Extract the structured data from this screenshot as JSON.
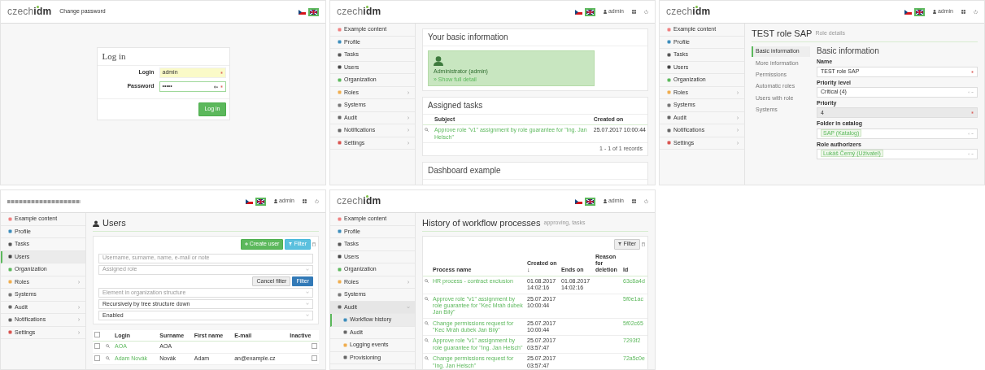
{
  "screens": [
    {
      "kind": "login",
      "header": {
        "logo": {
          "kind": "text",
          "text": "czech**idm**"
        },
        "links": [
          "Change password"
        ],
        "languages": [
          {
            "selected": false
          },
          {
            "selected": true
          }
        ]
      },
      "login": {
        "title": "Log in",
        "fields": [
          {
            "label": "Login",
            "value": "admin",
            "required": true,
            "autofilled": true,
            "secret": false
          },
          {
            "label": "Password",
            "value": "•••••",
            "required": true,
            "autofilled": false,
            "secret": true
          }
        ],
        "button": "Log in"
      }
    },
    {
      "kind": "dashboard",
      "header": {
        "logo": {
          "kind": "text",
          "text": "czech**idm**"
        },
        "languages": [
          {
            "selected": false
          },
          {
            "selected": true
          }
        ],
        "user": "admin"
      },
      "sidebar": [
        {
          "label": "Example content",
          "color": "#f08080",
          "has_submenu": false,
          "expanded": false,
          "selected": false
        },
        {
          "label": "Profile",
          "color": "#3c8dbc",
          "has_submenu": false,
          "expanded": false,
          "selected": false
        },
        {
          "label": "Tasks",
          "color": "#555555",
          "has_submenu": false,
          "expanded": false,
          "selected": false
        },
        {
          "label": "Users",
          "color": "#444444",
          "has_submenu": false,
          "expanded": false,
          "selected": false
        },
        {
          "label": "Organization",
          "color": "#5cb85c",
          "has_submenu": false,
          "expanded": false,
          "selected": false
        },
        {
          "label": "Roles",
          "color": "#f0ad4e",
          "has_submenu": true,
          "expanded": false,
          "selected": false
        },
        {
          "label": "Systems",
          "color": "#777777",
          "has_submenu": false,
          "expanded": false,
          "selected": false
        },
        {
          "label": "Audit",
          "color": "#666666",
          "has_submenu": true,
          "expanded": false,
          "selected": false
        },
        {
          "label": "Notifications",
          "color": "#666666",
          "has_submenu": true,
          "expanded": false,
          "selected": false
        },
        {
          "label": "Settings",
          "color": "#d9534f",
          "has_submenu": true,
          "expanded": false,
          "selected": false
        }
      ],
      "cards": [
        {
          "kind": "identity",
          "title": "Your basic information",
          "name": "Administrator (admin)",
          "link": "» Show full detail"
        },
        {
          "kind": "tasks",
          "title": "Assigned tasks",
          "columns": [
            "Subject",
            "Created on"
          ],
          "rows": [
            [
              "Approve role \"v1\" assignment by role guarantee for \"Ing. Jan Helsch\"",
              "25.07.2017 10:00:44"
            ]
          ],
          "pagination": "1 - 1 of 1 records"
        },
        {
          "kind": "notice",
          "title": "Dashboard example"
        }
      ]
    },
    {
      "kind": "role_detail",
      "header": {
        "logo": {
          "kind": "text",
          "text": "czech**idm**"
        },
        "languages": [
          {
            "selected": false
          },
          {
            "selected": true
          }
        ],
        "user": "admin"
      },
      "sidebar": [
        {
          "label": "Example content",
          "color": "#f08080",
          "has_submenu": false,
          "expanded": false,
          "selected": false
        },
        {
          "label": "Profile",
          "color": "#3c8dbc",
          "has_submenu": false,
          "expanded": false,
          "selected": false
        },
        {
          "label": "Tasks",
          "color": "#555555",
          "has_submenu": false,
          "expanded": false,
          "selected": false
        },
        {
          "label": "Users",
          "color": "#444444",
          "has_submenu": false,
          "expanded": false,
          "selected": false
        },
        {
          "label": "Organization",
          "color": "#5cb85c",
          "has_submenu": false,
          "expanded": false,
          "selected": false
        },
        {
          "label": "Roles",
          "color": "#f0ad4e",
          "has_submenu": true,
          "expanded": false,
          "selected": false
        },
        {
          "label": "Systems",
          "color": "#777777",
          "has_submenu": false,
          "expanded": false,
          "selected": false
        },
        {
          "label": "Audit",
          "color": "#666666",
          "has_submenu": true,
          "expanded": false,
          "selected": false
        },
        {
          "label": "Notifications",
          "color": "#666666",
          "has_submenu": true,
          "expanded": false,
          "selected": false
        },
        {
          "label": "Settings",
          "color": "#d9534f",
          "has_submenu": true,
          "expanded": false,
          "selected": false
        }
      ],
      "title": "TEST role SAP",
      "subtitle": "Role details",
      "tabs": [
        {
          "label": "Basic information",
          "selected": true
        },
        {
          "label": "More information",
          "selected": false
        },
        {
          "label": "Permissions",
          "selected": false
        },
        {
          "label": "Automatic roles",
          "selected": false
        },
        {
          "label": "Users with role",
          "selected": false
        },
        {
          "label": "Systems",
          "selected": false
        }
      ],
      "form": {
        "title": "Basic information",
        "fields": [
          {
            "kind": "text",
            "label": "Name",
            "value": "TEST role SAP",
            "required": true,
            "disabled": false
          },
          {
            "kind": "select",
            "label": "Priority level",
            "value": "Critical (4)",
            "required": false,
            "disabled": false
          },
          {
            "kind": "text",
            "label": "Priority",
            "value": "4",
            "required": true,
            "disabled": true
          },
          {
            "kind": "tags",
            "label": "Folder in catalog",
            "value": "SAP (Katalog)",
            "required": false,
            "disabled": false
          },
          {
            "kind": "tags",
            "label": "Role authorizers",
            "value": "Lukáš Černý (Uživatel)",
            "required": false,
            "disabled": false
          }
        ]
      }
    },
    {
      "kind": "users",
      "header": {
        "logo": {
          "kind": "image"
        },
        "languages": [
          {
            "selected": false
          },
          {
            "selected": true
          }
        ],
        "user": "admin"
      },
      "sidebar": [
        {
          "label": "Example content",
          "color": "#f08080",
          "has_submenu": false,
          "expanded": false,
          "selected": false
        },
        {
          "label": "Profile",
          "color": "#3c8dbc",
          "has_submenu": false,
          "expanded": false,
          "selected": false
        },
        {
          "label": "Tasks",
          "color": "#555555",
          "has_submenu": false,
          "expanded": false,
          "selected": false
        },
        {
          "label": "Users",
          "color": "#444444",
          "has_submenu": false,
          "expanded": false,
          "selected": true
        },
        {
          "label": "Organization",
          "color": "#5cb85c",
          "has_submenu": false,
          "expanded": false,
          "selected": false
        },
        {
          "label": "Roles",
          "color": "#f0ad4e",
          "has_submenu": true,
          "expanded": false,
          "selected": false
        },
        {
          "label": "Systems",
          "color": "#777777",
          "has_submenu": false,
          "expanded": false,
          "selected": false
        },
        {
          "label": "Audit",
          "color": "#666666",
          "has_submenu": true,
          "expanded": false,
          "selected": false
        },
        {
          "label": "Notifications",
          "color": "#666666",
          "has_submenu": true,
          "expanded": false,
          "selected": false
        },
        {
          "label": "Settings",
          "color": "#d9534f",
          "has_submenu": true,
          "expanded": false,
          "selected": false
        }
      ],
      "title": "Users",
      "toolbar": [
        {
          "kind": "create",
          "label": "Create user"
        },
        {
          "kind": "filter",
          "label": "Filter"
        }
      ],
      "filter": {
        "search_placeholder": "Username, surname, name, e-mail or note",
        "role_placeholder": "Assigned role",
        "cancel": "Cancel filter",
        "apply": "Filter",
        "tree_placeholder": "Element in organization structure",
        "recursion": "Recursively by tree structure down",
        "state": "Enabled"
      },
      "table": {
        "all_checked": false,
        "columns": [
          "Login",
          "Surname",
          "First name",
          "E-mail",
          "Inactive"
        ],
        "rows": [
          {
            "checked": false,
            "login": "AOA",
            "surname": "AOA",
            "inactive": false
          },
          {
            "checked": false,
            "login": "Adam Novák",
            "surname": "Novák",
            "first_name": "Adam",
            "email": "an@example.cz",
            "inactive": false
          }
        ]
      }
    },
    {
      "kind": "workflow_history",
      "header": {
        "logo": {
          "kind": "text",
          "text": "czech**idm**"
        },
        "languages": [
          {
            "selected": false
          },
          {
            "selected": true
          }
        ],
        "user": "admin"
      },
      "sidebar": [
        {
          "label": "Example content",
          "color": "#f08080",
          "has_submenu": false,
          "expanded": false,
          "selected": false
        },
        {
          "label": "Profile",
          "color": "#3c8dbc",
          "has_submenu": false,
          "expanded": false,
          "selected": false
        },
        {
          "label": "Tasks",
          "color": "#555555",
          "has_submenu": false,
          "expanded": false,
          "selected": false
        },
        {
          "label": "Users",
          "color": "#444444",
          "has_submenu": false,
          "expanded": false,
          "selected": false
        },
        {
          "label": "Organization",
          "color": "#5cb85c",
          "has_submenu": false,
          "expanded": false,
          "selected": false
        },
        {
          "label": "Roles",
          "color": "#f0ad4e",
          "has_submenu": true,
          "expanded": false,
          "selected": false
        },
        {
          "label": "Systems",
          "color": "#777777",
          "has_submenu": false,
          "expanded": false,
          "selected": false
        },
        {
          "label": "Audit",
          "color": "#666666",
          "has_submenu": true,
          "expanded": true,
          "selected": false,
          "children": [
            {
              "label": "Workflow history",
              "color": "#3c8dbc",
              "selected": true
            },
            {
              "label": "Audit",
              "color": "#666666",
              "selected": false
            },
            {
              "label": "Logging events",
              "color": "#f0ad4e",
              "selected": false
            },
            {
              "label": "Provisioning",
              "color": "#666666",
              "selected": false
            }
          ]
        }
      ],
      "title": "History of workflow processes",
      "subtitle": "approving, tasks",
      "filter_button": "Filter",
      "table": {
        "columns": [
          "Process name",
          "Created on ↓",
          "Ends on",
          "Reason for deletion",
          "Id"
        ],
        "rows": [
          {
            "name": "HR process - contract exclusion",
            "created": "01.08.2017 14:02:16",
            "ends": "01.08.2017 14:02:16",
            "id": "63c8a4d"
          },
          {
            "name": "Approve role \"v1\" assignment by role guarantee for \"Kec Mráh dubek Jan Bílý\"",
            "created": "25.07.2017 10:00:44",
            "id": "5f0e1ac"
          },
          {
            "name": "Change permissions request for \"Kec Mráh dubek Jan Bílý\"",
            "created": "25.07.2017 10:00:44",
            "id": "5f02c65"
          },
          {
            "name": "Approve role \"v1\" assignment by role guarantee for \"Ing. Jan Helsch\"",
            "created": "25.07.2017 03:57:47",
            "id": "7293f2"
          },
          {
            "name": "Change permissions request for \"Ing. Jan Helsch\"",
            "created": "25.07.2017 03:57:47",
            "id": "72a5c0e"
          }
        ]
      }
    }
  ]
}
